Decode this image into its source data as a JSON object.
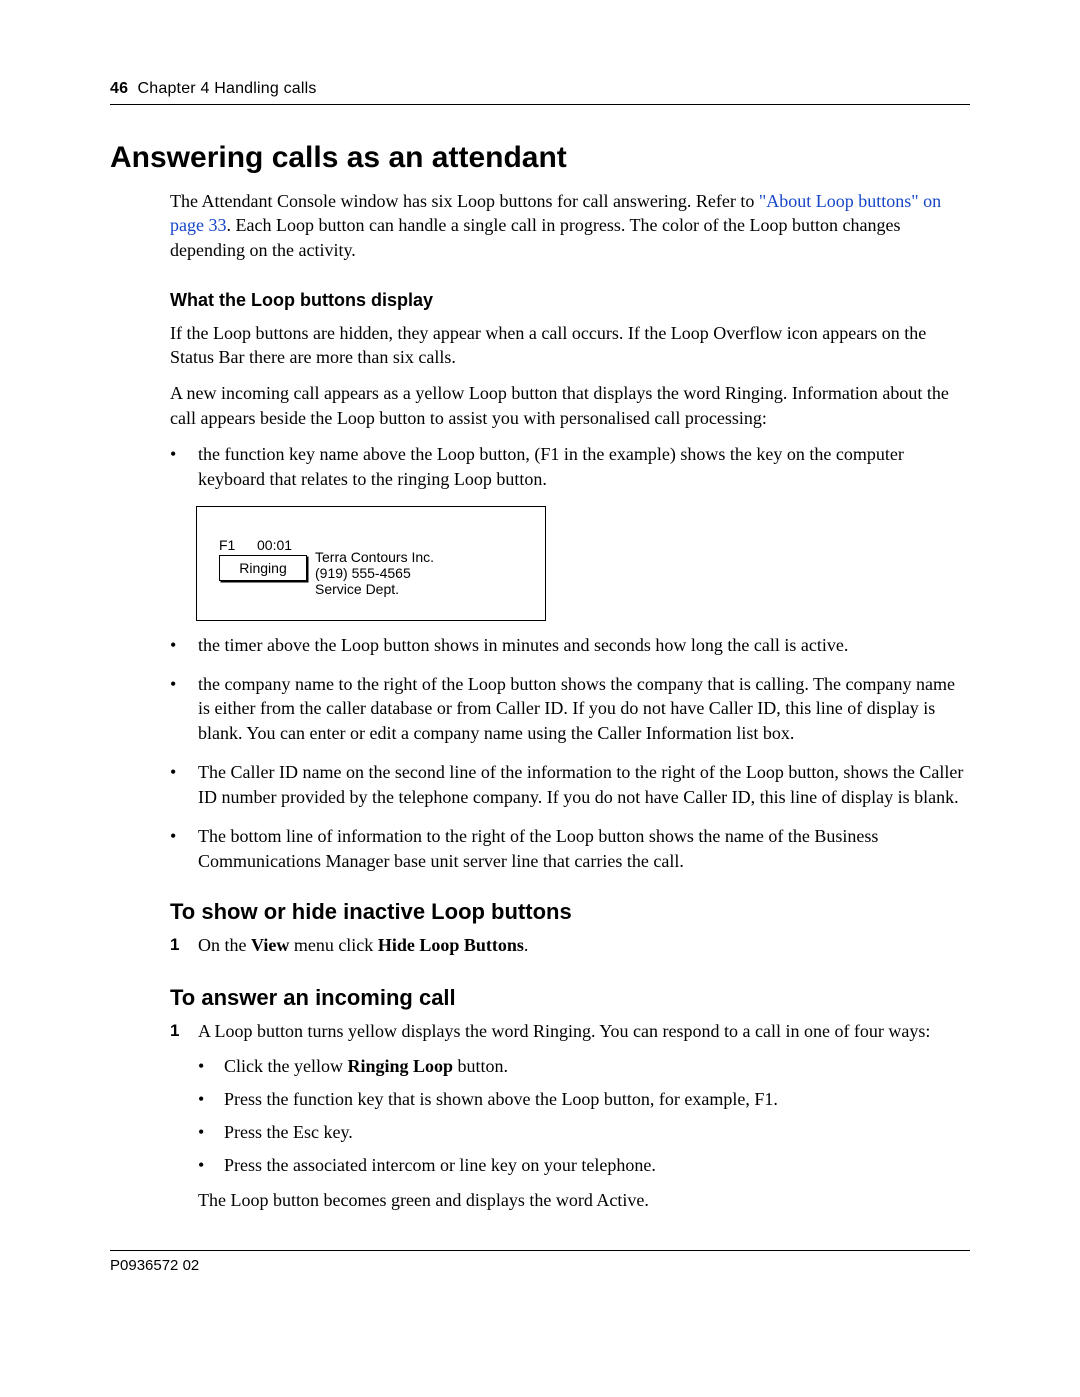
{
  "header": {
    "page_number": "46",
    "chapter_label": "Chapter 4  Handling calls"
  },
  "h1": "Answering calls as an attendant",
  "intro": {
    "pre_link": "The Attendant Console window has six Loop buttons for call answering. Refer to ",
    "link": "\"About Loop buttons\" on page 33",
    "post_link": ". Each Loop button can handle a single call in progress. The color of the Loop button changes depending on the activity."
  },
  "loop_display": {
    "title": "What the Loop buttons display",
    "p1": "If the Loop buttons are hidden, they appear when a call occurs. If the Loop Overflow icon appears on the Status Bar there are more than six calls.",
    "p2": "A new incoming call appears as a yellow Loop button that displays the word Ringing. Information about the call appears beside the Loop button to assist you with personalised call processing:",
    "b1": "the function key name above the Loop button, (F1 in the example) shows the key on the computer keyboard that relates to the ringing Loop button.",
    "figure": {
      "key": "F1",
      "timer": "00:01",
      "button_label": "Ringing",
      "info_line1": "Terra Contours Inc.",
      "info_line2": "(919) 555-4565",
      "info_line3": "Service Dept."
    },
    "b2": "the timer above the Loop button shows in minutes and seconds how long the call is active.",
    "b3": "the company name to the right of the Loop button shows the company that is calling. The company name is either from the caller database or from Caller ID. If you do not have Caller ID, this line of display is blank. You can enter or edit a company name using the Caller Information list box.",
    "b4": "The Caller ID name on the second line of the information to the right of the Loop button, shows the Caller ID number provided by the telephone company. If you do not have Caller ID, this line of display is blank.",
    "b5": "The bottom line of information to the right of the Loop button shows the name of the Business Communications Manager base unit server line that carries the call."
  },
  "show_hide": {
    "title": "To show or hide inactive Loop buttons",
    "step1_pre": "On the ",
    "step1_b1": "View",
    "step1_mid": " menu click ",
    "step1_b2": "Hide Loop Buttons",
    "step1_post": "."
  },
  "answer": {
    "title": "To answer an incoming call",
    "step1_main": "A Loop button turns yellow displays the word Ringing. You can respond to a call in one of four ways:",
    "inner1_pre": "Click the yellow ",
    "inner1_b": "Ringing Loop",
    "inner1_post": " button.",
    "inner2": "Press the function key that is shown above the Loop button, for example, F1.",
    "inner3": "Press the Esc key.",
    "inner4": "Press the associated intercom or line key on your telephone.",
    "after": "The Loop button becomes green and displays the word Active."
  },
  "footer": {
    "doc_id": "P0936572 02"
  }
}
